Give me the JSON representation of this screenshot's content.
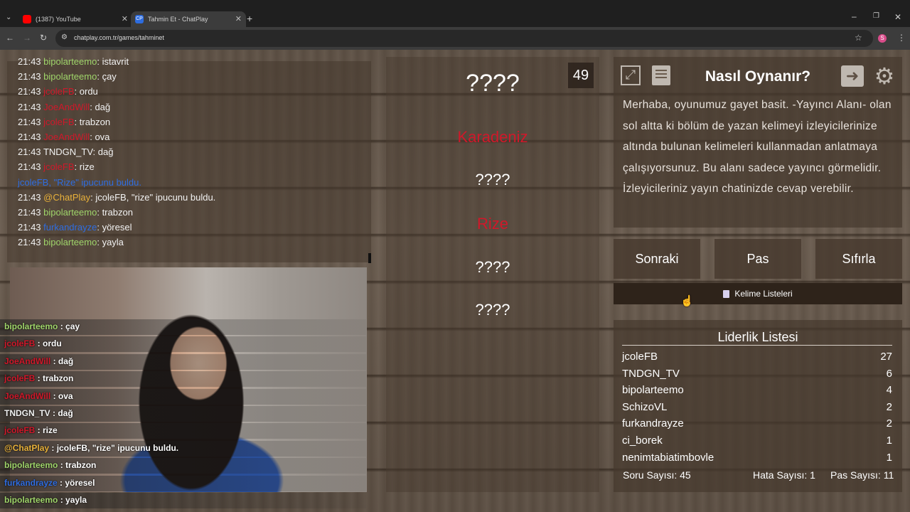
{
  "browser": {
    "tabs": [
      {
        "label": "(1387) YouTube",
        "fav_color": "#ff0000"
      },
      {
        "label": "Tahmin Et - ChatPlay",
        "fav_color": "#2d6cdf"
      }
    ],
    "url": "chatplay.com.tr/games/tahminet",
    "profile_initial": "S"
  },
  "chat": {
    "lines": [
      {
        "time": "21:43",
        "user": "bipolarteemo",
        "color": "#9fd46a",
        "sep": ": ",
        "msg": "istavrit"
      },
      {
        "time": "21:43",
        "user": "bipolarteemo",
        "color": "#9fd46a",
        "sep": ": ",
        "msg": "çay"
      },
      {
        "time": "21:43",
        "user": "jcoleFB",
        "color": "#d0182a",
        "sep": ": ",
        "msg": "ordu"
      },
      {
        "time": "21:43",
        "user": "JoeAndWill",
        "color": "#d0182a",
        "sep": ": ",
        "msg": "dağ"
      },
      {
        "time": "21:43",
        "user": "jcoleFB",
        "color": "#d0182a",
        "sep": ": ",
        "msg": "trabzon"
      },
      {
        "time": "21:43",
        "user": "JoeAndWill",
        "color": "#d0182a",
        "sep": ": ",
        "msg": "ova"
      },
      {
        "time": "21:43",
        "user": "TNDGN_TV",
        "color": "#f2f2f2",
        "sep": ": ",
        "msg": "dağ"
      },
      {
        "time": "21:43",
        "user": "jcoleFB",
        "color": "#d0182a",
        "sep": ": ",
        "msg": "rize"
      },
      {
        "time": "",
        "user": "jcoleFB, \"Rize\" ipucunu buldu.",
        "color": "#2f6de0",
        "sep": "",
        "msg": ""
      },
      {
        "time": "21:43",
        "user": "@ChatPlay",
        "color": "#e8b13a",
        "sep": ": ",
        "msg": "jcoleFB, \"rize\" ipucunu buldu."
      },
      {
        "time": "21:43",
        "user": "bipolarteemo",
        "color": "#9fd46a",
        "sep": ": ",
        "msg": "trabzon"
      },
      {
        "time": "21:43",
        "user": "furkandrayze",
        "color": "#2f6de0",
        "sep": ": ",
        "msg": "yöresel"
      },
      {
        "time": "21:43",
        "user": "bipolarteemo",
        "color": "#9fd46a",
        "sep": ": ",
        "msg": "yayla"
      }
    ]
  },
  "overlay_chat": {
    "lines": [
      {
        "user": "bipolarteemo",
        "color": "#9fd46a",
        "msg": " : çay"
      },
      {
        "user": "jcoleFB",
        "color": "#d0182a",
        "msg": " : ordu"
      },
      {
        "user": "JoeAndWill",
        "color": "#d0182a",
        "msg": " : dağ"
      },
      {
        "user": "jcoleFB",
        "color": "#d0182a",
        "msg": " : trabzon"
      },
      {
        "user": "JoeAndWill",
        "color": "#d0182a",
        "msg": " : ova"
      },
      {
        "user": "TNDGN_TV",
        "color": "#f2f2f2",
        "msg": " : dağ"
      },
      {
        "user": "jcoleFB",
        "color": "#d0182a",
        "msg": " : rize"
      },
      {
        "user": "@ChatPlay",
        "color": "#e8b13a",
        "msg": " : jcoleFB, \"rize\" ipucunu buldu."
      },
      {
        "user": "bipolarteemo",
        "color": "#9fd46a",
        "msg": " : trabzon"
      },
      {
        "user": "furkandrayze",
        "color": "#2f6de0",
        "msg": " : yöresel"
      },
      {
        "user": "bipolarteemo",
        "color": "#9fd46a",
        "msg": " : yayla"
      }
    ]
  },
  "game": {
    "timer": "49",
    "words": [
      {
        "text": "????",
        "color": "#ffffff",
        "size": 34
      },
      {
        "text": "Karadeniz",
        "color": "#d0182a",
        "size": 22
      },
      {
        "text": "????",
        "color": "#ffffff",
        "size": 22
      },
      {
        "text": "Rize",
        "color": "#d0182a",
        "size": 22
      },
      {
        "text": "????",
        "color": "#ffffff",
        "size": 22
      },
      {
        "text": "????",
        "color": "#ffffff",
        "size": 22
      }
    ]
  },
  "howto": {
    "title": "Nasıl Oynanır?",
    "text": "Merhaba, oyunumuz gayet basit. -Yayıncı Alanı- olan sol altta ki bölüm de yazan kelimeyi izleyicilerinize altında bulunan kelimeleri kullanmadan anlatmaya çalışıyorsunuz. Bu alanı sadece yayıncı görmelidir. İzleyicileriniz yayın chatinizde cevap verebilir."
  },
  "buttons": {
    "next": "Sonraki",
    "pass": "Pas",
    "reset": "Sıfırla",
    "word_lists": "Kelime Listeleri"
  },
  "leaderboard": {
    "title": "Liderlik Listesi",
    "rows": [
      {
        "name": "jcoleFB",
        "score": "27"
      },
      {
        "name": "TNDGN_TV",
        "score": "6"
      },
      {
        "name": "bipolarteemo",
        "score": "4"
      },
      {
        "name": "SchizoVL",
        "score": "2"
      },
      {
        "name": "furkandrayze",
        "score": "2"
      },
      {
        "name": "ci_borek",
        "score": "1"
      },
      {
        "name": "nenimtabiatimboyle",
        "score": "1"
      }
    ],
    "question_count": "Soru Sayısı: 45",
    "error_count": "Hata Sayısı: 1",
    "pass_count": "Pas Sayısı: 11"
  }
}
